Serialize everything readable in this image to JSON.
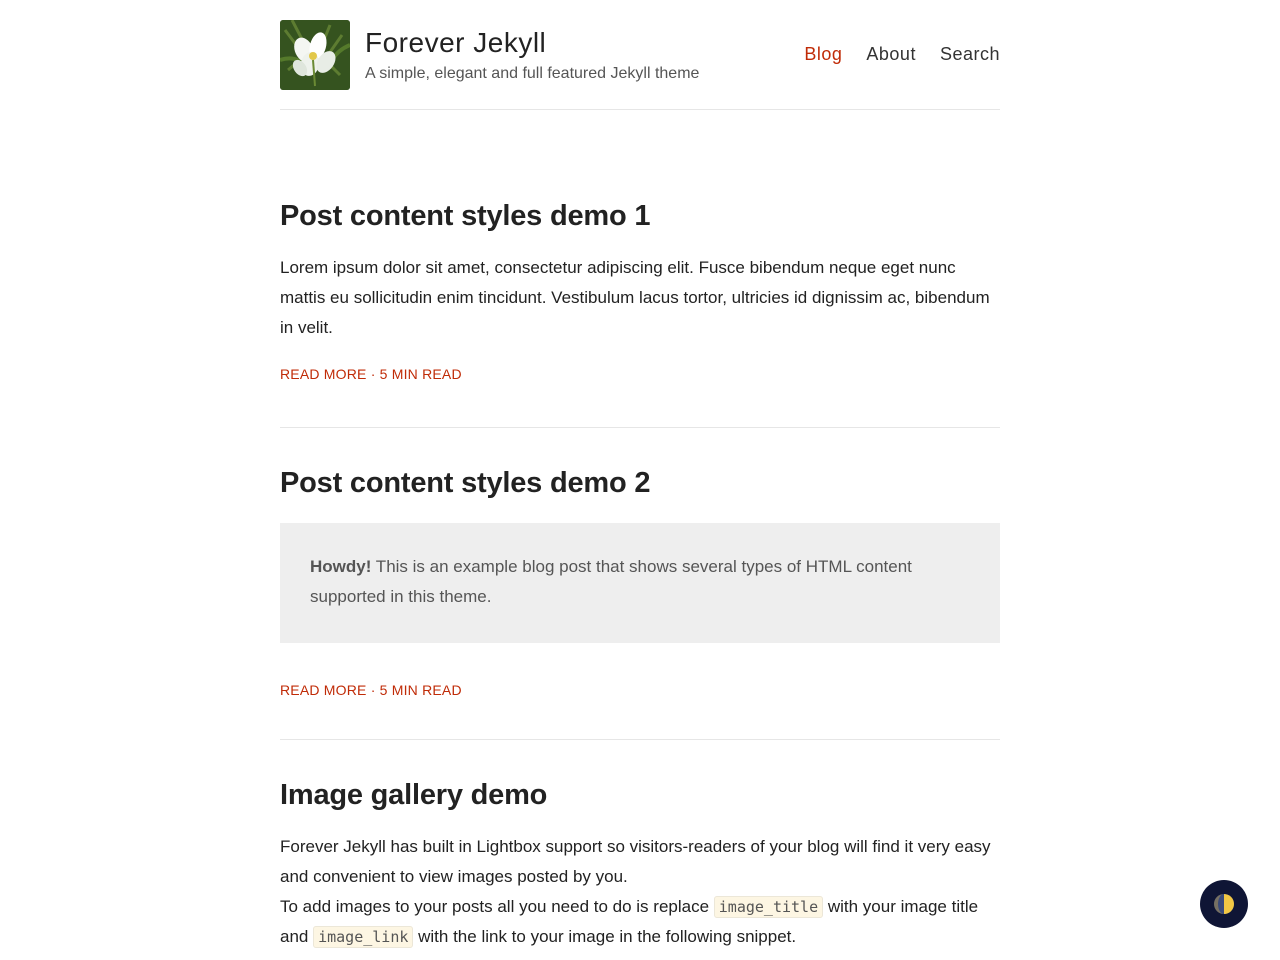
{
  "header": {
    "title": "Forever Jekyll",
    "description": "A simple, elegant and full featured Jekyll theme",
    "logo_icon": "white-flower-logo",
    "nav": [
      {
        "label": "Blog",
        "active": true
      },
      {
        "label": "About",
        "active": false
      },
      {
        "label": "Search",
        "active": false
      }
    ]
  },
  "posts": [
    {
      "title": "Post content styles demo 1",
      "excerpt": "Lorem ipsum dolor sit amet, consectetur adipiscing elit. Fusce bibendum neque eget nunc mattis eu sollicitudin enim tincidunt. Vestibulum lacus tortor, ultricies id dignissim ac, bibendum in velit.",
      "read_more": "READ MORE",
      "separator": "·",
      "read_time": "5 MIN READ"
    },
    {
      "title": "Post content styles demo 2",
      "callout_bold": "Howdy!",
      "callout_text": " This is an example blog post that shows several types of HTML content supported in this theme.",
      "read_more": "READ MORE",
      "separator": "·",
      "read_time": "5 MIN READ"
    },
    {
      "title": "Image gallery demo",
      "paragraph1": "Forever Jekyll has built in Lightbox support so visitors-readers of your blog will find it very easy and convenient to view images posted by you.",
      "p2_a": "To add images to your posts all you need to do is replace ",
      "p2_code1": "image_title",
      "p2_b": " with your image title and ",
      "p2_code2": "image_link",
      "p2_c": " with the link to your image in the following snippet."
    }
  ],
  "theme_toggle": {
    "icon": "half-moon-icon"
  },
  "colors": {
    "accent": "#c02b07",
    "callout_bg": "#eeeeee",
    "toggle_bg": "#0f1535"
  }
}
